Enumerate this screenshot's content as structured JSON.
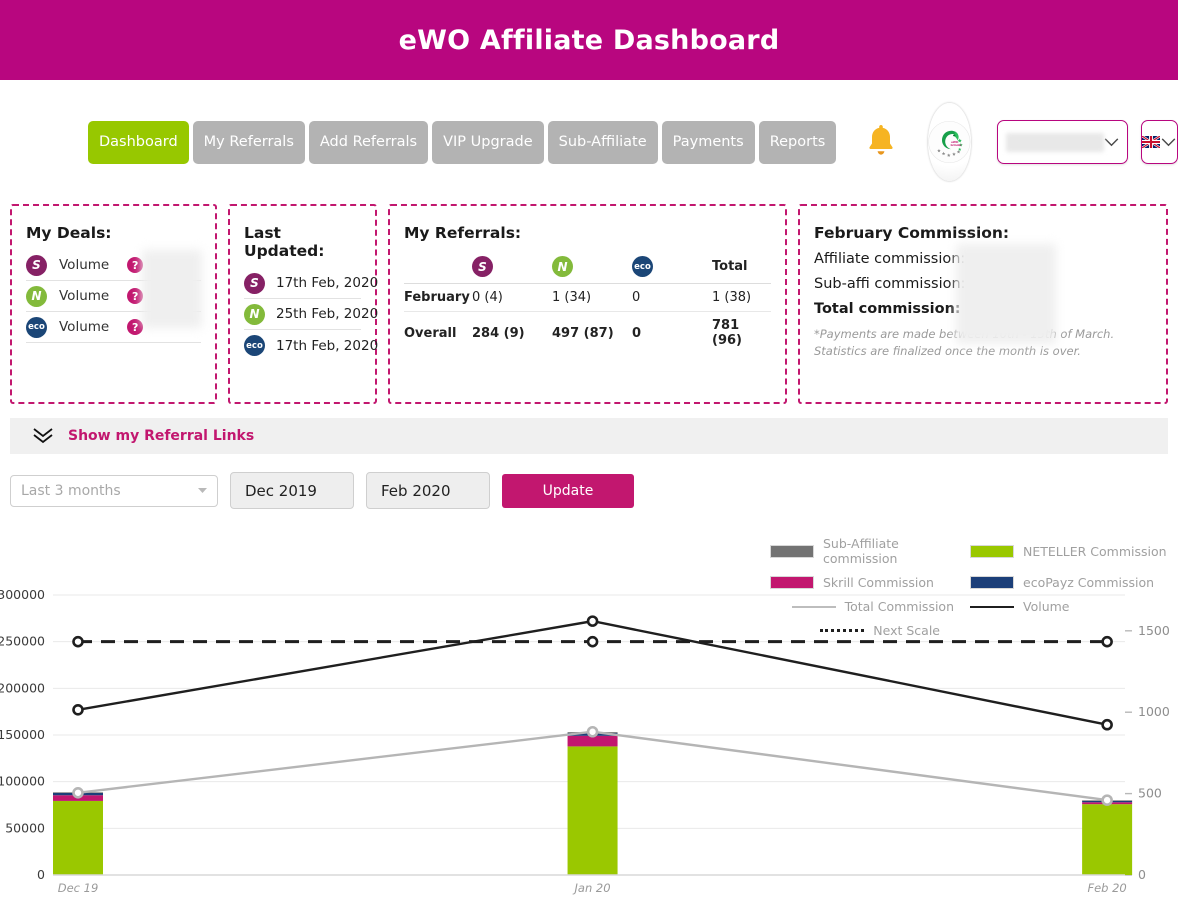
{
  "header": {
    "title": "eWO Affiliate Dashboard",
    "brand_color": "#b8067f",
    "accent_green": "#97c800"
  },
  "nav": {
    "items": [
      {
        "label": "Dashboard",
        "active": true
      },
      {
        "label": "My Referrals",
        "active": false
      },
      {
        "label": "Add Referrals",
        "active": false
      },
      {
        "label": "VIP Upgrade",
        "active": false
      },
      {
        "label": "Sub-Affiliate",
        "active": false
      },
      {
        "label": "Payments",
        "active": false
      },
      {
        "label": "Reports",
        "active": false
      }
    ],
    "bell_icon": "bell-icon",
    "logo_icon": "ewo-grinder-logo",
    "logo_text": "eWO Grinder",
    "account_select": {
      "value": "",
      "chevron": "chevron-down-icon"
    },
    "language_select": {
      "value": "GB",
      "flag": "uk-flag-icon",
      "chevron": "chevron-down-icon"
    }
  },
  "cards": {
    "my_deals": {
      "title": "My Deals:",
      "rows": [
        {
          "brand": "S",
          "brand_name": "skrill",
          "label": "Volume",
          "help": "?"
        },
        {
          "brand": "N",
          "brand_name": "neteller",
          "label": "Volume",
          "help": "?"
        },
        {
          "brand": "eco",
          "brand_name": "ecopayz",
          "label": "Volume",
          "help": "?"
        }
      ]
    },
    "last_updated": {
      "title": "Last Updated:",
      "rows": [
        {
          "brand": "S",
          "brand_name": "skrill",
          "date": "17th Feb, 2020"
        },
        {
          "brand": "N",
          "brand_name": "neteller",
          "date": "25th Feb, 2020"
        },
        {
          "brand": "eco",
          "brand_name": "ecopayz",
          "date": "17th Feb, 2020"
        }
      ]
    },
    "my_referrals": {
      "title": "My Referrals:",
      "columns": [
        "",
        "S",
        "N",
        "eco",
        "Total"
      ],
      "rows": [
        {
          "label": "February",
          "skrill": "0 (4)",
          "neteller": "1 (34)",
          "ecopayz": "0",
          "total": "1 (38)"
        },
        {
          "label": "Overall",
          "skrill": "284 (9)",
          "neteller": "497 (87)",
          "ecopayz": "0",
          "total": "781 (96)"
        }
      ]
    },
    "commission": {
      "title": "February Commission:",
      "affiliate_label": "Affiliate commission:",
      "subaffi_label": "Sub-affi commission:",
      "total_label": "Total commission:",
      "note": "*Payments are made between 10th - 15th of March. Statistics are finalized once the month is over."
    }
  },
  "referral_links": {
    "label": "Show my Referral Links",
    "icon": "chevron-double-down-icon"
  },
  "filters": {
    "range_select": {
      "value": "Last 3 months",
      "chevron": "chevron-down-icon"
    },
    "from_date": "Dec 2019",
    "to_date": "Feb 2020",
    "update_label": "Update"
  },
  "legend": [
    {
      "name": "Sub-Affiliate commission",
      "type": "swatch",
      "color": "#737373"
    },
    {
      "name": "NETELLER Commission",
      "type": "swatch",
      "color": "#9ac800"
    },
    {
      "name": "Skrill Commission",
      "type": "swatch",
      "color": "#c2176f"
    },
    {
      "name": "ecoPayz Commission",
      "type": "swatch",
      "color": "#1c3f79"
    },
    {
      "name": "Total Commission",
      "type": "line",
      "color": "#b5b5b5"
    },
    {
      "name": "Volume",
      "type": "line",
      "color": "#1f1f1f"
    },
    {
      "name": "Next Scale",
      "type": "dashed",
      "color": "#1f1f1f"
    }
  ],
  "chart_data": {
    "type": "bar",
    "title": "",
    "xlabel": "",
    "ylabel": "",
    "categories": [
      "Dec 19",
      "Jan 20",
      "Feb 20"
    ],
    "left_axis": {
      "label": "",
      "ticks": [
        0,
        50000,
        100000,
        150000,
        200000,
        250000,
        300000
      ],
      "tick_labels": [
        "0",
        "50000",
        "100000",
        "150000",
        "200000",
        "250000",
        "300000"
      ],
      "ylim": [
        0,
        300000
      ]
    },
    "right_axis": {
      "label": "",
      "ticks": [
        0,
        500,
        1000,
        1500
      ],
      "tick_labels": [
        "0",
        "500",
        "1000",
        "1500"
      ],
      "ylim": [
        0,
        1720
      ]
    },
    "series": [
      {
        "name": "NETELLER Commission",
        "type": "bar",
        "stack": "commission",
        "axis": "right",
        "color": "#9ac800",
        "values": [
          455,
          790,
          435
        ]
      },
      {
        "name": "Skrill Commission",
        "type": "bar",
        "stack": "commission",
        "axis": "right",
        "color": "#c2176f",
        "values": [
          35,
          65,
          12
        ]
      },
      {
        "name": "ecoPayz Commission",
        "type": "bar",
        "stack": "commission",
        "axis": "right",
        "color": "#1c3f79",
        "values": [
          14,
          18,
          8
        ]
      },
      {
        "name": "Sub-Affiliate commission",
        "type": "bar",
        "stack": "commission",
        "axis": "right",
        "color": "#737373",
        "values": [
          4,
          5,
          4
        ]
      },
      {
        "name": "Total Commission",
        "type": "line",
        "axis": "right",
        "color": "#b5b5b5",
        "values": [
          505,
          880,
          460
        ]
      },
      {
        "name": "Volume",
        "type": "line",
        "axis": "left",
        "color": "#1f1f1f",
        "values": [
          177000,
          272000,
          161000
        ]
      },
      {
        "name": "Next Scale",
        "type": "dashed-line",
        "axis": "left",
        "color": "#1f1f1f",
        "values": [
          250000,
          250000,
          250000
        ]
      }
    ],
    "grid": true,
    "legend_position": "top-right"
  }
}
